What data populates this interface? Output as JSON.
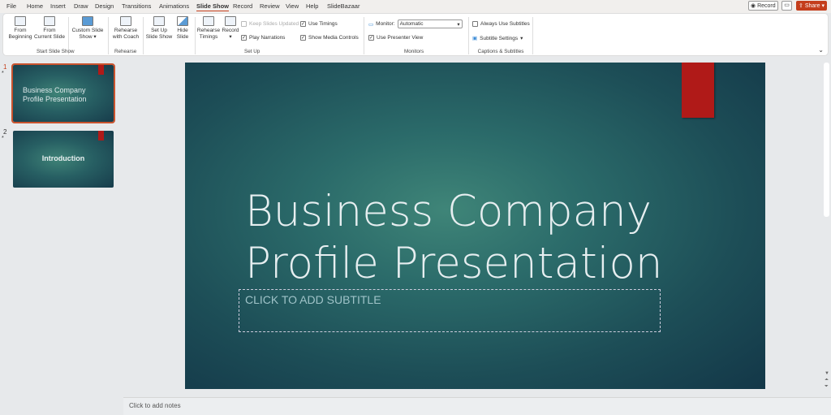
{
  "tabs": [
    "File",
    "Home",
    "Insert",
    "Draw",
    "Design",
    "Transitions",
    "Animations",
    "Slide Show",
    "Record",
    "Review",
    "View",
    "Help",
    "SlideBazaar"
  ],
  "active_tab": "Slide Show",
  "top_right": {
    "record": "Record",
    "share": "Share"
  },
  "ribbon": {
    "from_beginning": "From Beginning",
    "from_current": "From Current Slide",
    "custom_show": "Custom Slide Show",
    "group_start": "Start Slide Show",
    "rehearse_coach": "Rehearse with Coach",
    "group_rehearse": "Rehearse",
    "setup_show": "Set Up Slide Show",
    "hide_slide": "Hide Slide",
    "rehearse_timings": "Rehearse Timings",
    "record": "Record",
    "keep_updated": "Keep Slides Updated",
    "play_narrations": "Play Narrations",
    "use_timings": "Use Timings",
    "show_media": "Show Media Controls",
    "group_setup": "Set Up",
    "monitor_label": "Monitor:",
    "monitor_value": "Automatic",
    "presenter_view": "Use Presenter View",
    "group_monitors": "Monitors",
    "always_subtitles": "Always Use Subtitles",
    "subtitle_settings": "Subtitle Settings",
    "group_captions": "Captions & Subtitles"
  },
  "slides": [
    {
      "num": "1",
      "title": "Business Company Profile Presentation"
    },
    {
      "num": "2",
      "title": "Introduction"
    }
  ],
  "slide": {
    "title_line1": "Business Company",
    "title_line2": "Profile Presentation",
    "subtitle_placeholder": "CLICK TO ADD SUBTITLE"
  },
  "notes_placeholder": "Click to add notes",
  "colors": {
    "accent": "#c43e1c",
    "slide_red": "#b01a18",
    "slide_teal": "#2b6b6a"
  }
}
